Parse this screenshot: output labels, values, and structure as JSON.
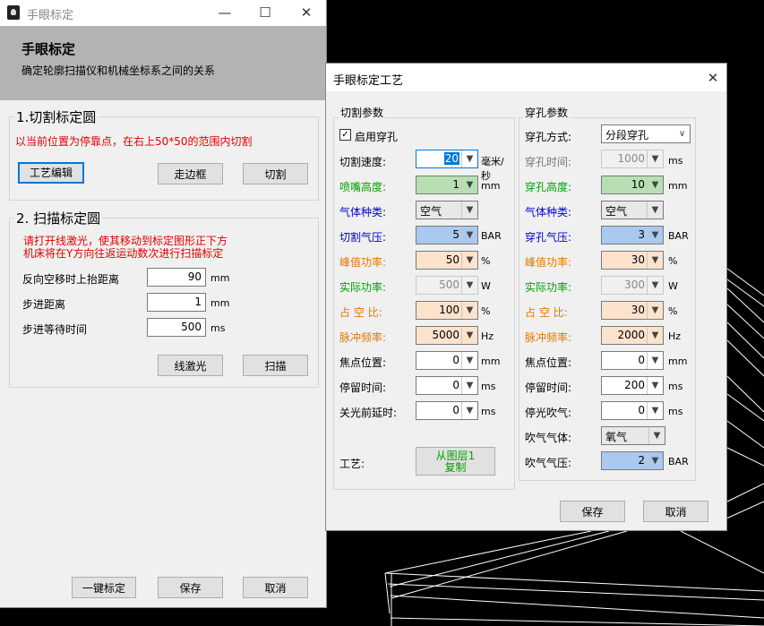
{
  "main_window": {
    "title": "手眼标定",
    "banner_title": "手眼标定",
    "banner_subtitle": "确定轮廓扫描仪和机械坐标系之间的关系",
    "section1": {
      "title": "1.切割标定圆",
      "hint": "以当前位置为停靠点，在右上50*50的范围内切割",
      "btn_process_edit": "工艺编辑",
      "btn_trace_frame": "走边框",
      "btn_cut": "切割"
    },
    "section2": {
      "title": "2. 扫描标定圆",
      "hint_line1": "请打开线激光，使其移动到标定图形正下方",
      "hint_line2": "机床将在Y方向往返运动数次进行扫描标定",
      "fields": [
        {
          "label": "反向空移时上抬距离",
          "value": "90",
          "unit": "mm"
        },
        {
          "label": "步进距离",
          "value": "1",
          "unit": "mm"
        },
        {
          "label": "步进等待时间",
          "value": "500",
          "unit": "ms"
        }
      ],
      "btn_line_laser": "线激光",
      "btn_scan": "扫描"
    },
    "footer": {
      "btn_one_click": "一键标定",
      "btn_save": "保存",
      "btn_cancel": "取消"
    }
  },
  "dialog": {
    "title": "手眼标定工艺",
    "cut_params": {
      "title": "切割参数",
      "enable_pierce_label": "启用穿孔",
      "enable_pierce_checked": "✓",
      "rows": [
        {
          "label": "切割速度:",
          "value": "20",
          "unit": "毫米/秒"
        },
        {
          "label": "喷嘴高度:",
          "value": "1",
          "unit": "mm"
        },
        {
          "label": "气体种类:",
          "value": "空气",
          "unit": ""
        },
        {
          "label": "切割气压:",
          "value": "5",
          "unit": "BAR"
        },
        {
          "label": "峰值功率:",
          "value": "50",
          "unit": "%"
        },
        {
          "label": "实际功率:",
          "value": "500",
          "unit": "W"
        },
        {
          "label": "占 空 比:",
          "value": "100",
          "unit": "%"
        },
        {
          "label": "脉冲频率:",
          "value": "5000",
          "unit": "Hz"
        },
        {
          "label": "焦点位置:",
          "value": "0",
          "unit": "mm"
        },
        {
          "label": "停留时间:",
          "value": "0",
          "unit": "ms"
        },
        {
          "label": "关光前延时:",
          "value": "0",
          "unit": "ms"
        }
      ],
      "process_label": "工艺:",
      "copy_btn_line1": "从图层1",
      "copy_btn_line2": "复制"
    },
    "pierce_params": {
      "title": "穿孔参数",
      "rows": [
        {
          "label": "穿孔方式:",
          "value": "分段穿孔",
          "unit": ""
        },
        {
          "label": "穿孔时间:",
          "value": "1000",
          "unit": "ms"
        },
        {
          "label": "穿孔高度:",
          "value": "10",
          "unit": "mm"
        },
        {
          "label": "气体种类:",
          "value": "空气",
          "unit": ""
        },
        {
          "label": "穿孔气压:",
          "value": "3",
          "unit": "BAR"
        },
        {
          "label": "峰值功率:",
          "value": "30",
          "unit": "%"
        },
        {
          "label": "实际功率:",
          "value": "300",
          "unit": "W"
        },
        {
          "label": "占 空 比:",
          "value": "30",
          "unit": "%"
        },
        {
          "label": "脉冲频率:",
          "value": "2000",
          "unit": "Hz"
        },
        {
          "label": "焦点位置:",
          "value": "0",
          "unit": "mm"
        },
        {
          "label": "停留时间:",
          "value": "200",
          "unit": "ms"
        },
        {
          "label": "停光吹气:",
          "value": "0",
          "unit": "ms"
        },
        {
          "label": "吹气气体:",
          "value": "氧气",
          "unit": ""
        },
        {
          "label": "吹气气压:",
          "value": "2",
          "unit": "BAR"
        }
      ]
    },
    "btn_save": "保存",
    "btn_cancel": "取消"
  },
  "colors": {
    "green_field": "#b7dfb3",
    "blue_field": "#a9c9ef",
    "peach_field": "#fde2cc",
    "label_green": "#00a000",
    "label_blue": "#0000cc",
    "label_orange": "#e07800",
    "hint_red": "#e00000"
  }
}
